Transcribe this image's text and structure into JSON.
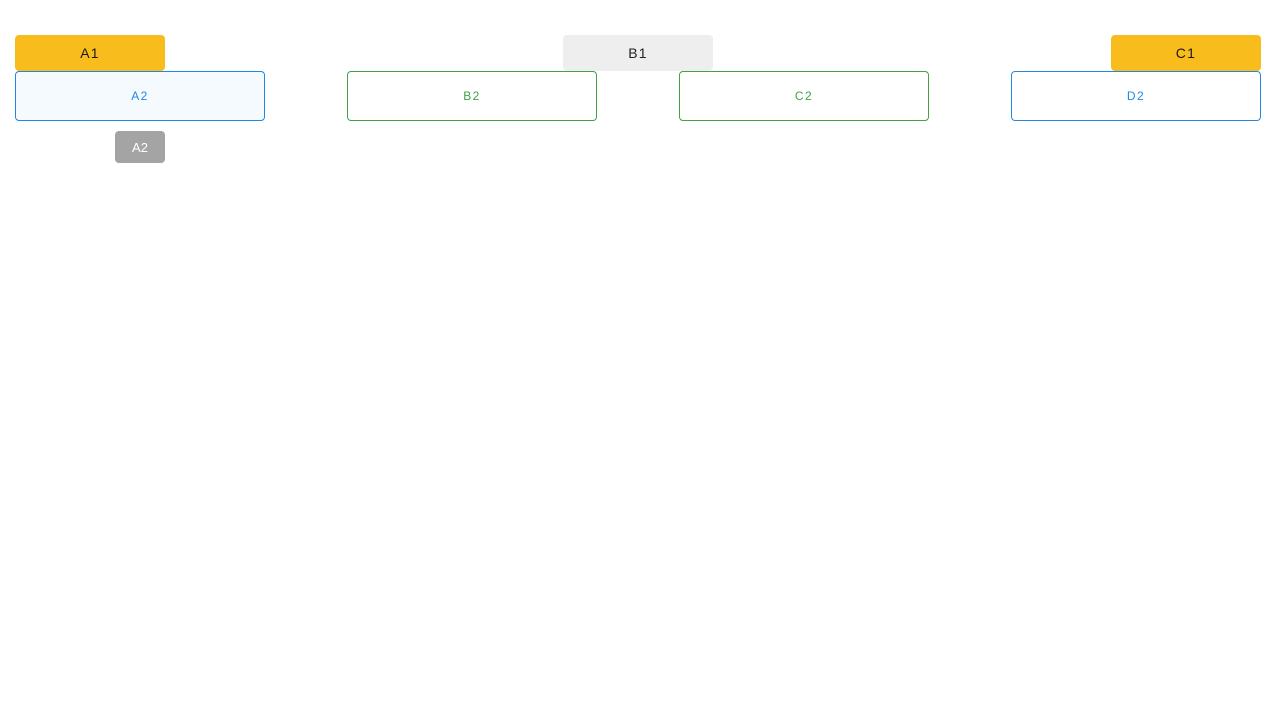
{
  "top_row": {
    "a1_label": "A1",
    "b1_label": "B1",
    "c1_label": "C1"
  },
  "second_row": {
    "a2_label": "A2",
    "b2_label": "B2",
    "c2_label": "C2",
    "d2_label": "D2"
  },
  "tooltip": {
    "label": "A2"
  },
  "colors": {
    "accent_yellow": "#f8bd1c",
    "neutral_grey": "#eeeeee",
    "outline_blue": "#1e88e5",
    "outline_green": "#43a047",
    "tooltip_grey": "#a4a4a4"
  }
}
